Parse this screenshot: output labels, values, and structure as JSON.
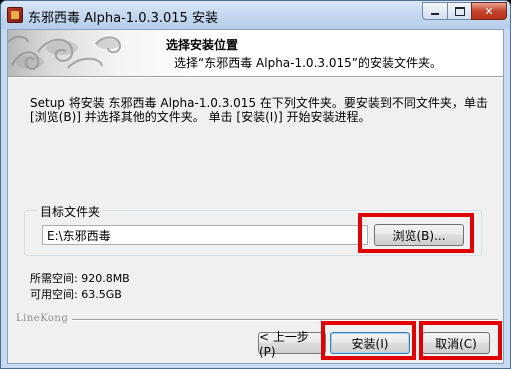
{
  "window": {
    "title": "东邪西毒 Alpha-1.0.3.015 安装",
    "controls": {
      "minimize": "",
      "maximize": "",
      "close": "✕"
    }
  },
  "header": {
    "title": "选择安装位置",
    "subtitle": "选择“东邪西毒 Alpha-1.0.3.015”的安装文件夹。"
  },
  "description": "Setup 将安装 东邪西毒 Alpha-1.0.3.015 在下列文件夹。要安装到不同文件夹，单击 [浏览(B)] 并选择其他的文件夹。 单击 [安装(I)] 开始安装进程。",
  "destination": {
    "group_label": "目标文件夹",
    "path": "E:\\东邪西毒",
    "browse_label": "浏览(B)..."
  },
  "space": {
    "required": "所需空间: 920.8MB",
    "available": "可用空间: 63.5GB"
  },
  "brand": "LineKong",
  "buttons": {
    "back": "< 上一步(P)",
    "install": "安装(I)",
    "cancel": "取消(C)"
  },
  "highlight_color": "#e00000"
}
